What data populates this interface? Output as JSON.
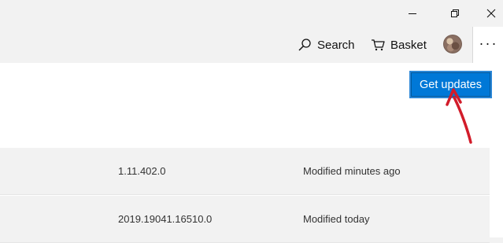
{
  "window_controls": {
    "minimize_icon": "minimize-icon",
    "restore_icon": "restore-icon",
    "close_icon": "close-icon"
  },
  "toolbar": {
    "search_label": "Search",
    "basket_label": "Basket",
    "more_label": "···"
  },
  "main": {
    "get_updates_label": "Get updates"
  },
  "downloads": [
    {
      "version": "1.11.402.0",
      "modified": "Modified minutes ago"
    },
    {
      "version": "2019.19041.16510.0",
      "modified": "Modified today"
    }
  ],
  "colors": {
    "accent": "#0078d7",
    "annotation_arrow": "#d21c2a"
  }
}
